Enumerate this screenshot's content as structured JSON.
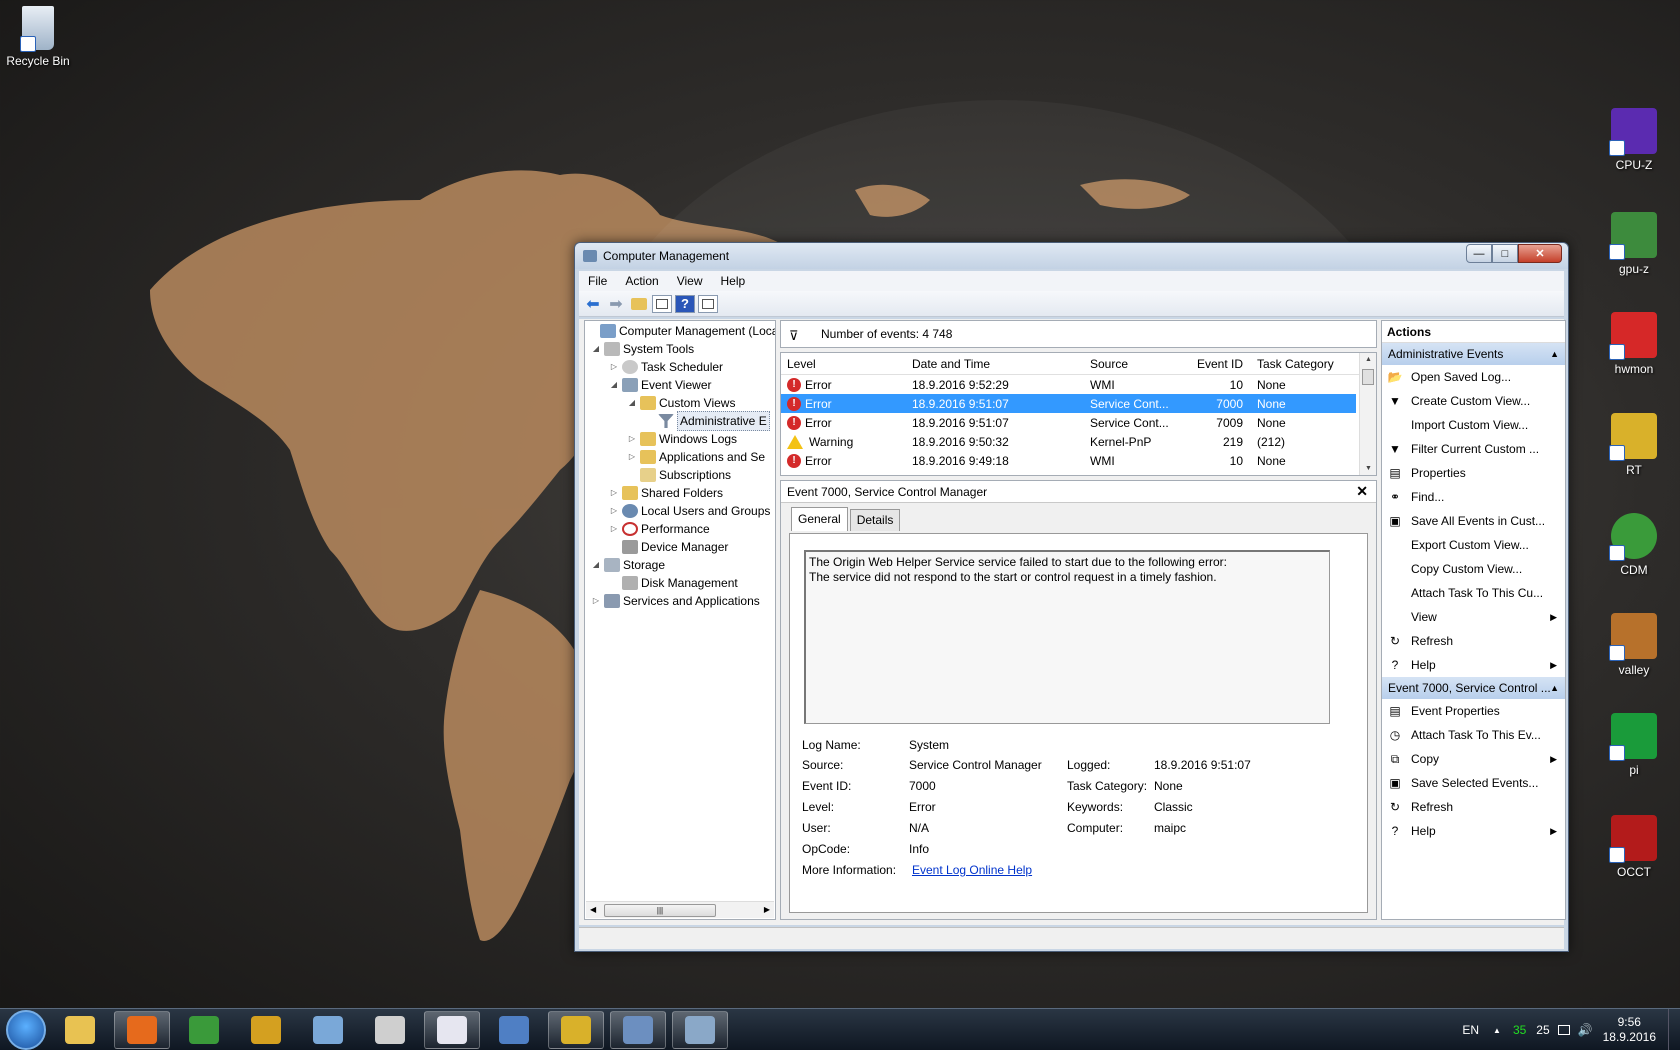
{
  "desktop": {
    "left_icons": [
      {
        "label": "Recycle Bin"
      }
    ],
    "right_icons": [
      {
        "label": "CPU-Z",
        "color": "#5b2bb0"
      },
      {
        "label": "gpu-z",
        "color": "#3d8b3d"
      },
      {
        "label": "hwmon",
        "color": "#d62828"
      },
      {
        "label": "RT",
        "color": "#d9b12a"
      },
      {
        "label": "CDM",
        "color": "#3a9b3a"
      },
      {
        "label": "valley",
        "color": "#b7712b"
      },
      {
        "label": "pi",
        "color": "#1a9b3a"
      },
      {
        "label": "OCCT",
        "color": "#b31b1b"
      }
    ]
  },
  "window": {
    "title": "Computer Management",
    "controls": {
      "minimize": "—",
      "maximize": "□",
      "close": "✕"
    }
  },
  "menu": [
    "File",
    "Action",
    "View",
    "Help"
  ],
  "tree": {
    "items": [
      {
        "label": "Computer Management (Local",
        "depth": 0,
        "expander": ""
      },
      {
        "label": "System Tools",
        "depth": 1,
        "expander": "◢"
      },
      {
        "label": "Task Scheduler",
        "depth": 2,
        "expander": "▷"
      },
      {
        "label": "Event Viewer",
        "depth": 2,
        "expander": "◢"
      },
      {
        "label": "Custom Views",
        "depth": 3,
        "expander": "◢"
      },
      {
        "label": "Administrative E",
        "depth": 4,
        "expander": "",
        "selected": true
      },
      {
        "label": "Windows Logs",
        "depth": 3,
        "expander": "▷"
      },
      {
        "label": "Applications and Se",
        "depth": 3,
        "expander": "▷"
      },
      {
        "label": "Subscriptions",
        "depth": 3,
        "expander": ""
      },
      {
        "label": "Shared Folders",
        "depth": 2,
        "expander": "▷"
      },
      {
        "label": "Local Users and Groups",
        "depth": 2,
        "expander": "▷"
      },
      {
        "label": "Performance",
        "depth": 2,
        "expander": "▷"
      },
      {
        "label": "Device Manager",
        "depth": 2,
        "expander": ""
      },
      {
        "label": "Storage",
        "depth": 1,
        "expander": "◢"
      },
      {
        "label": "Disk Management",
        "depth": 2,
        "expander": ""
      },
      {
        "label": "Services and Applications",
        "depth": 1,
        "expander": "▷"
      }
    ],
    "scroll_thumb_glyph": "|||"
  },
  "events": {
    "count_label": "Number of events: 4 748",
    "columns": [
      "Level",
      "Date and Time",
      "Source",
      "Event ID",
      "Task Category"
    ],
    "rows": [
      {
        "level": "Error",
        "type": "error",
        "datetime": "18.9.2016 9:52:29",
        "source": "WMI",
        "event_id": "10",
        "category": "None"
      },
      {
        "level": "Error",
        "type": "error",
        "datetime": "18.9.2016 9:51:07",
        "source": "Service Cont...",
        "event_id": "7000",
        "category": "None",
        "selected": true
      },
      {
        "level": "Error",
        "type": "error",
        "datetime": "18.9.2016 9:51:07",
        "source": "Service Cont...",
        "event_id": "7009",
        "category": "None"
      },
      {
        "level": "Warning",
        "type": "warning",
        "datetime": "18.9.2016 9:50:32",
        "source": "Kernel-PnP",
        "event_id": "219",
        "category": "(212)"
      },
      {
        "level": "Error",
        "type": "error",
        "datetime": "18.9.2016 9:49:18",
        "source": "WMI",
        "event_id": "10",
        "category": "None"
      }
    ]
  },
  "detail": {
    "title": "Event 7000, Service Control Manager",
    "close": "✕",
    "tabs": [
      "General",
      "Details"
    ],
    "message_line1": "The Origin Web Helper Service service failed to start due to the following error:",
    "message_line2": "The service did not respond to the start or control request in a timely fashion.",
    "props": {
      "log_name_label": "Log Name:",
      "log_name": "System",
      "source_label": "Source:",
      "source": "Service Control Manager",
      "logged_label": "Logged:",
      "logged": "18.9.2016 9:51:07",
      "event_id_label": "Event ID:",
      "event_id": "7000",
      "task_category_label": "Task Category:",
      "task_category": "None",
      "level_label": "Level:",
      "level": "Error",
      "keywords_label": "Keywords:",
      "keywords": "Classic",
      "user_label": "User:",
      "user": "N/A",
      "computer_label": "Computer:",
      "computer": "maipc",
      "opcode_label": "OpCode:",
      "opcode": "Info",
      "more_info_label": "More Information:",
      "more_info_link": "Event Log Online Help"
    }
  },
  "actions": {
    "header": "Actions",
    "section1": "Administrative Events",
    "items1": [
      {
        "label": "Open Saved Log...",
        "icon": "open-folder-icon",
        "glyph": "📂"
      },
      {
        "label": "Create Custom View...",
        "icon": "filter-icon",
        "glyph": "▼"
      },
      {
        "label": "Import Custom View...",
        "icon": "",
        "glyph": ""
      },
      {
        "label": "Filter Current Custom ...",
        "icon": "filter-icon",
        "glyph": "▼"
      },
      {
        "label": "Properties",
        "icon": "properties-icon",
        "glyph": "▤"
      },
      {
        "label": "Find...",
        "icon": "binoculars-icon",
        "glyph": "⚭"
      },
      {
        "label": "Save All Events in Cust...",
        "icon": "save-icon",
        "glyph": "▣"
      },
      {
        "label": "Export Custom View...",
        "icon": "",
        "glyph": ""
      },
      {
        "label": "Copy Custom View...",
        "icon": "",
        "glyph": ""
      },
      {
        "label": "Attach Task To This Cu...",
        "icon": "",
        "glyph": ""
      },
      {
        "label": "View",
        "icon": "",
        "glyph": "",
        "submenu": "▶"
      },
      {
        "label": "Refresh",
        "icon": "refresh-icon",
        "glyph": "↻"
      },
      {
        "label": "Help",
        "icon": "help-icon",
        "glyph": "?",
        "submenu": "▶"
      }
    ],
    "section2": "Event 7000, Service Control ...",
    "items2": [
      {
        "label": "Event Properties",
        "icon": "properties-icon",
        "glyph": "▤"
      },
      {
        "label": "Attach Task To This Ev...",
        "icon": "task-icon",
        "glyph": "◷"
      },
      {
        "label": "Copy",
        "icon": "copy-icon",
        "glyph": "⧉",
        "submenu": "▶"
      },
      {
        "label": "Save Selected Events...",
        "icon": "save-icon",
        "glyph": "▣"
      },
      {
        "label": "Refresh",
        "icon": "refresh-icon",
        "glyph": "↻"
      },
      {
        "label": "Help",
        "icon": "help-icon",
        "glyph": "?",
        "submenu": "▶"
      }
    ]
  },
  "taskbar": {
    "apps": [
      {
        "icon": "explorer-icon",
        "color": "#e8c252",
        "open": false
      },
      {
        "icon": "firefox-icon",
        "color": "#e66a1c",
        "open": true
      },
      {
        "icon": "chrome-icon",
        "color": "#3a9a3a",
        "open": false
      },
      {
        "icon": "winamp-icon",
        "color": "#d4a020",
        "open": false
      },
      {
        "icon": "notes-icon",
        "color": "#7aa8d8",
        "open": false
      },
      {
        "icon": "video-icon",
        "color": "#cfcfcf",
        "open": false
      },
      {
        "icon": "document-icon",
        "color": "#e6e6f0",
        "open": true
      },
      {
        "icon": "thunderbird-icon",
        "color": "#4f7fc4",
        "open": false
      },
      {
        "icon": "realtemp-icon",
        "color": "#d9b12a",
        "open": true
      },
      {
        "icon": "remote-icon",
        "color": "#6c8fc0",
        "open": true
      },
      {
        "icon": "computer-management-icon",
        "color": "#8aa8c8",
        "open": true
      }
    ],
    "tray": {
      "lang": "EN",
      "arrow": "▲",
      "temp1": "35",
      "temp2": "25",
      "volume": "🔊",
      "time": "9:56",
      "date": "18.9.2016",
      "temp1_color": "#22dd22"
    }
  }
}
